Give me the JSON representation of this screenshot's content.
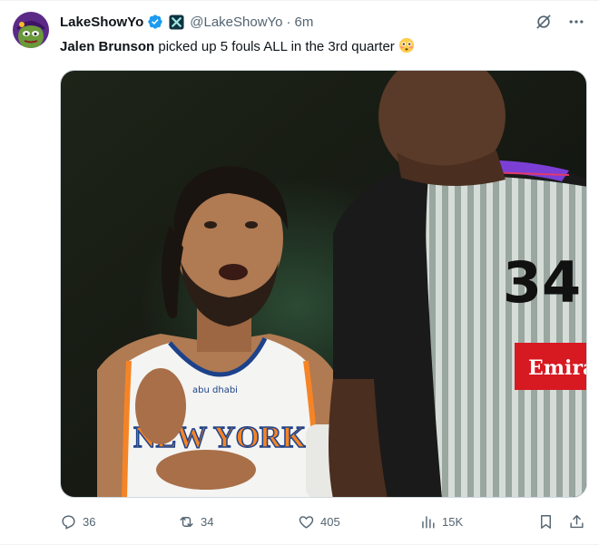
{
  "tweet": {
    "display_name": "LakeShowYo",
    "handle": "@LakeShowYo",
    "separator": "·",
    "timestamp": "6m",
    "text_bold": "Jalen Brunson",
    "text_rest": " picked up 5 fouls ALL in the 3rd quarter",
    "emoji": "flushed-face",
    "media": {
      "jersey_text": "NEW YORK",
      "jersey_sponsor": "abu dhabi",
      "referee_number": "34",
      "referee_patch": "Emirat"
    }
  },
  "actions": {
    "replies": "36",
    "reposts": "34",
    "likes": "405",
    "views": "15K"
  },
  "colors": {
    "text": "#0f1419",
    "muted": "#536471",
    "verified": "#1d9bf0",
    "knicks_orange": "#f58426",
    "knicks_blue": "#1d428a",
    "emirates_red": "#d71921"
  }
}
